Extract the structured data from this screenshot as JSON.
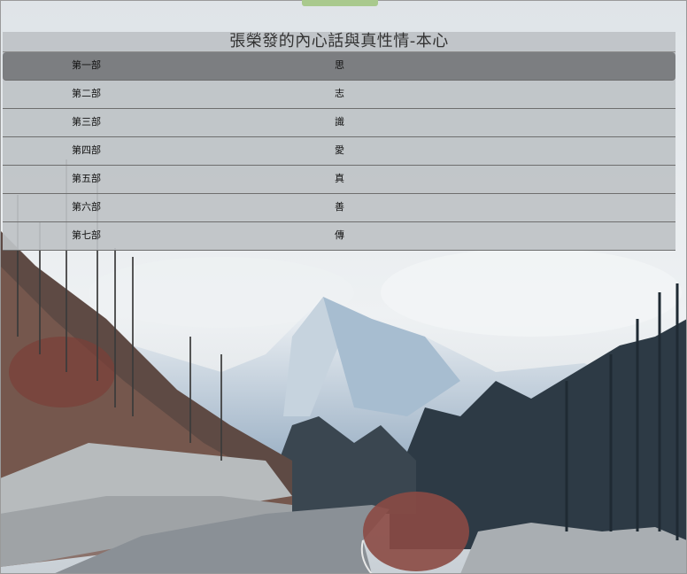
{
  "page": {
    "title": "張榮發的內心話與真性情-本心"
  },
  "menu": {
    "items": [
      {
        "part": "第一部",
        "name": "思",
        "active": true
      },
      {
        "part": "第二部",
        "name": "志"
      },
      {
        "part": "第三部",
        "name": "識"
      },
      {
        "part": "第四部",
        "name": "愛"
      },
      {
        "part": "第五部",
        "name": "真"
      },
      {
        "part": "第六部",
        "name": "善"
      },
      {
        "part": "第七部",
        "name": "傳"
      }
    ]
  },
  "colors": {
    "accent_tab": "#a9c98d",
    "panel": "#bec2c6",
    "active_row": "#787a7d"
  }
}
